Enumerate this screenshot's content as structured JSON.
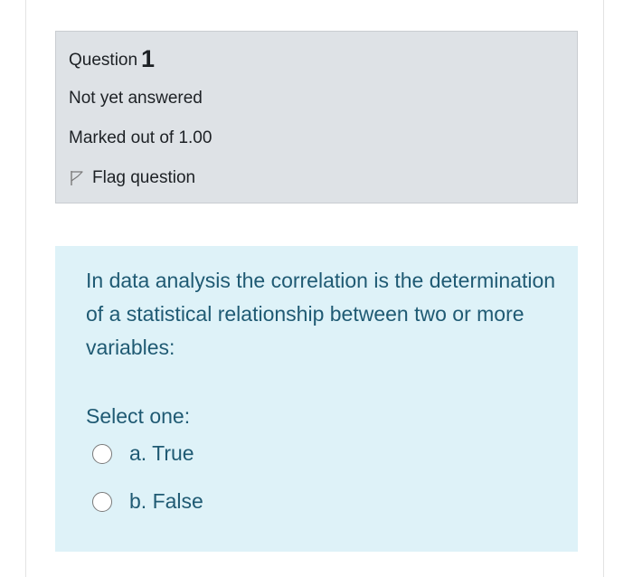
{
  "info": {
    "question_label": "Question",
    "question_number": "1",
    "state": "Not yet answered",
    "grade": "Marked out of 1.00",
    "flag_label": "Flag question"
  },
  "question": {
    "text": "In data analysis the correlation is the determination of a statistical relationship between two or more variables:",
    "prompt": "Select one:",
    "options": [
      {
        "label": "a. True",
        "selected": false
      },
      {
        "label": "b. False",
        "selected": false
      }
    ]
  },
  "icons": {
    "flag": "flag-outline-icon",
    "radio": "radio-unchecked-icon"
  },
  "colors": {
    "info_background": "#dee2e6",
    "content_background": "#def2f8",
    "question_text": "#1f5a73"
  }
}
